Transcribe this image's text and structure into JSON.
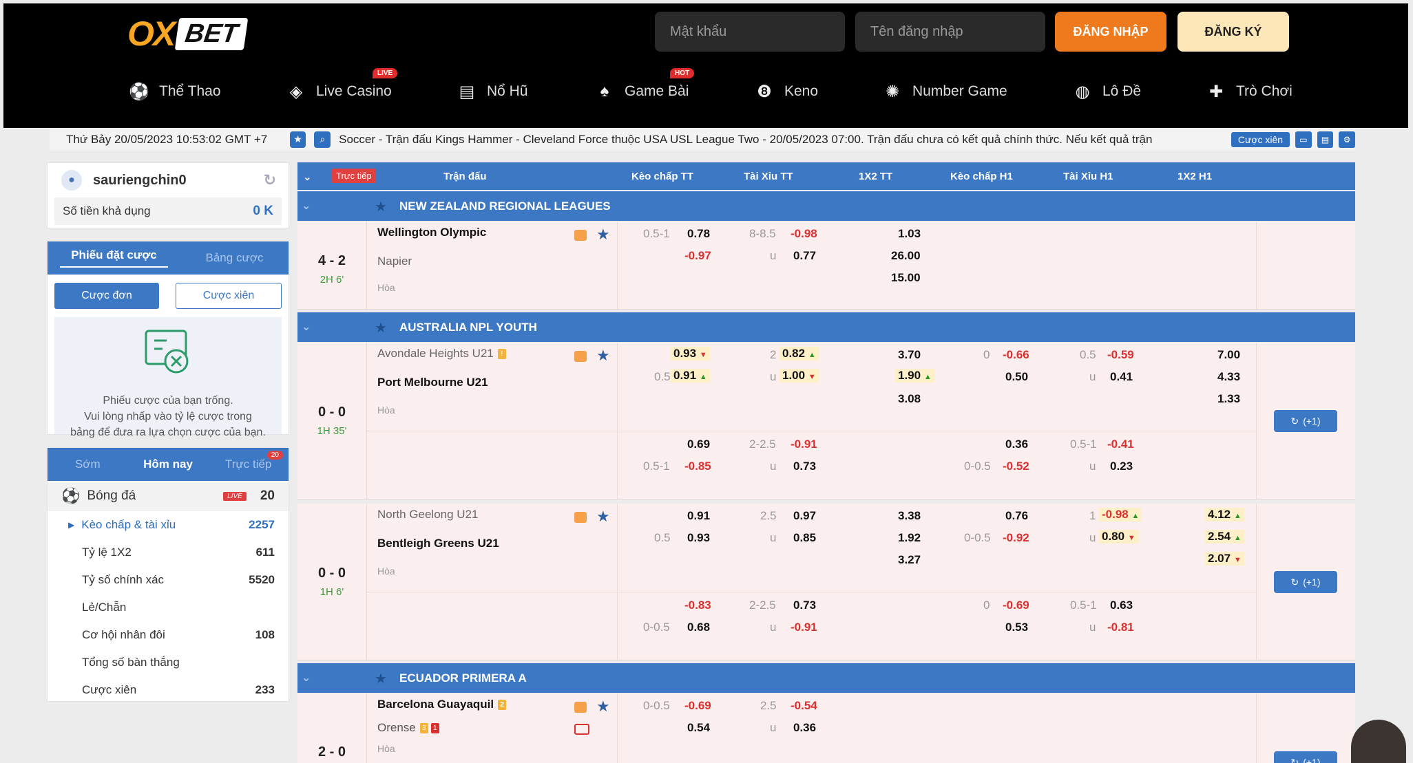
{
  "header": {
    "logo_ox": "OX",
    "logo_bet": "BET",
    "password_placeholder": "Mật khẩu",
    "username_placeholder": "Tên đăng nhập",
    "login": "ĐĂNG NHẬP",
    "register": "ĐĂNG KÝ",
    "nav": [
      {
        "label": "Thể Thao",
        "icon": "soccer-ball-icon"
      },
      {
        "label": "Live Casino",
        "icon": "mask-icon",
        "badge": "LIVE"
      },
      {
        "label": "Nổ Hũ",
        "icon": "slot-machine-icon"
      },
      {
        "label": "Game Bài",
        "icon": "spade-icon",
        "badge": "HOT"
      },
      {
        "label": "Keno",
        "icon": "keno-ball-icon"
      },
      {
        "label": "Number Game",
        "icon": "number-wheel-icon"
      },
      {
        "label": "Lô Đề",
        "icon": "lottery-globe-icon"
      },
      {
        "label": "Trò Chơi",
        "icon": "gamepad-icon"
      }
    ]
  },
  "ticker": {
    "datetime": "Thứ Bảy 20/05/2023 10:53:02 GMT +7",
    "message": "Soccer - Trận đấu Kings Hammer - Cleveland Force thuộc USA USL League Two - 20/05/2023 07:00. Trận đấu chưa có kết quả chính thức. Nếu kết quả trận",
    "parlay": "Cược xiên"
  },
  "user": {
    "name": "sauriengchin0",
    "balance_label": "Số tiền khả dụng",
    "balance_value": "0 K"
  },
  "betslip": {
    "tab1": "Phiếu đặt cược",
    "tab2": "Bảng cược",
    "single": "Cược đơn",
    "parlay": "Cược xiên",
    "empty_line1": "Phiếu cược của bạn trống.",
    "empty_line2": "Vui lòng nhấp vào tỷ lệ cược trong",
    "empty_line3": "bảng để đưa ra lựa chọn cược của bạn."
  },
  "sports_menu": {
    "tab_early": "Sớm",
    "tab_today": "Hôm nay",
    "tab_live": "Trực tiếp",
    "tab_live_count": "20",
    "sport": "Bóng đá",
    "sport_live": "LIVE",
    "sport_count": "20",
    "items": [
      {
        "label": "Kèo chấp & tài xỉu",
        "count": "2257"
      },
      {
        "label": "Tỷ lệ 1X2",
        "count": "611"
      },
      {
        "label": "Tỷ số chính xác",
        "count": "5520"
      },
      {
        "label": "Lẻ/Chẵn",
        "count": ""
      },
      {
        "label": "Cơ hội nhân đôi",
        "count": "108"
      },
      {
        "label": "Tổng số bàn thắng",
        "count": ""
      },
      {
        "label": "Cược xiên",
        "count": "233"
      }
    ]
  },
  "table": {
    "live": "Trực tiếp",
    "match": "Trận đấu",
    "h1": "Kèo chấp TT",
    "h2": "Tài Xỉu TT",
    "h3": "1X2 TT",
    "h4": "Kèo chấp H1",
    "h5": "Tài Xỉu H1",
    "h6": "1X2 H1",
    "info": "i",
    "draw": "Hòa",
    "u": "u",
    "more": "(+1)"
  },
  "leagues": [
    {
      "name": "NEW ZEALAND REGIONAL LEAGUES"
    },
    {
      "name": "AUSTRALIA NPL YOUTH"
    },
    {
      "name": "ECUADOR PRIMERA A"
    }
  ],
  "m1": {
    "score": "4 - 2",
    "minute": "2H 6'",
    "home": "Wellington Olympic",
    "away": "Napier",
    "hc_line": "0.5-1",
    "hc_home": "0.78",
    "hc_away": "-0.97",
    "ou_line": "8-8.5",
    "ou_over": "-0.98",
    "ou_under": "0.77",
    "x1": "1.03",
    "x2": "26.00",
    "xd": "15.00"
  },
  "m2": {
    "score": "0 - 0",
    "minute": "1H 35'",
    "home": "Avondale Heights U21",
    "away": "Port Melbourne U21",
    "r1": {
      "hc_home": "0.93",
      "hc_line": "0.5",
      "hc_away": "0.91",
      "ou_line": "2",
      "ou_over": "0.82",
      "ou_under": "1.00",
      "x1": "3.70",
      "x2": "1.90",
      "xd": "3.08",
      "h1_line": "0",
      "h1_home": "-0.66",
      "h1_away": "0.50",
      "t1_line": "0.5",
      "t1_over": "-0.59",
      "t1_under": "0.41",
      "y1": "7.00",
      "y2": "4.33",
      "yd": "1.33"
    },
    "r2": {
      "hc_home": "0.69",
      "hc_line": "0.5-1",
      "hc_away": "-0.85",
      "ou_line": "2-2.5",
      "ou_over": "-0.91",
      "ou_under": "0.73",
      "h1_home": "0.36",
      "h1_line": "0-0.5",
      "h1_away": "-0.52",
      "t1_line": "0.5-1",
      "t1_over": "-0.41",
      "t1_under": "0.23"
    }
  },
  "m3": {
    "score": "0 - 0",
    "minute": "1H 6'",
    "home": "North Geelong U21",
    "away": "Bentleigh Greens U21",
    "r1": {
      "hc_home": "0.91",
      "hc_line": "0.5",
      "hc_away": "0.93",
      "ou_line": "2.5",
      "ou_over": "0.97",
      "ou_under": "0.85",
      "x1": "3.38",
      "x2": "1.92",
      "xd": "3.27",
      "h1_home": "0.76",
      "h1_line": "0-0.5",
      "h1_away": "-0.92",
      "t1_line": "1",
      "t1_over": "-0.98",
      "t1_under": "0.80",
      "y1": "4.12",
      "y2": "2.54",
      "yd": "2.07"
    },
    "r2": {
      "hc_home": "-0.83",
      "hc_line": "0-0.5",
      "hc_away": "0.68",
      "ou_line": "2-2.5",
      "ou_over": "0.73",
      "ou_under": "-0.91",
      "h1_line": "0",
      "h1_home": "-0.69",
      "h1_away": "0.53",
      "t1_line": "0.5-1",
      "t1_over": "0.63",
      "t1_under": "-0.81"
    }
  },
  "m4": {
    "score": "2 - 0",
    "home": "Barcelona Guayaquil",
    "home_card": "2",
    "away": "Orense",
    "away_card_y": "3",
    "away_card_r": "1",
    "hc_line": "0-0.5",
    "hc_home": "-0.69",
    "hc_away": "0.54",
    "ou_line": "2.5",
    "ou_over": "-0.54",
    "ou_under": "0.36"
  },
  "warn_card": "!"
}
